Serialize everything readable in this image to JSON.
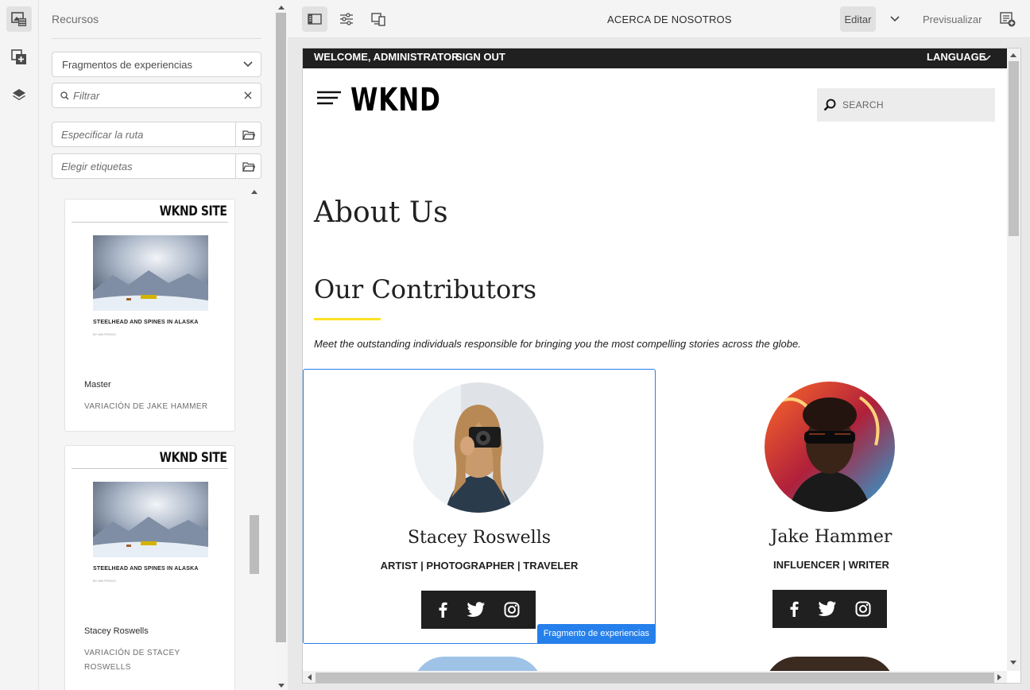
{
  "side_panel": {
    "title": "Recursos",
    "type_select": "Fragmentos de experiencias",
    "filter_placeholder": "Filtrar",
    "path_placeholder": "Especificar la ruta",
    "tags_placeholder": "Elegir etiquetas",
    "cards": [
      {
        "thumb_header": "WKND SITE",
        "thumb_caption": "STEELHEAD AND SPINES IN ALASKA",
        "thumb_byline": "BY IAN PROVO",
        "title": "Master",
        "subtitle": "VARIACIÓN DE JAKE HAMMER"
      },
      {
        "thumb_header": "WKND SITE",
        "thumb_caption": "STEELHEAD AND SPINES IN ALASKA",
        "thumb_byline": "BY IAN PROVO",
        "title": "Stacey Roswells",
        "subtitle": "VARIACIÓN DE STACEY ROSWELLS"
      }
    ]
  },
  "toolbar": {
    "page_name": "ACERCA DE NOSOTROS",
    "edit_label": "Editar",
    "preview_label": "Previsualizar"
  },
  "site": {
    "welcome": "WELCOME, ADMINISTRATOR",
    "sign_out": "SIGN OUT",
    "language": "LANGUAGE",
    "logo": "WKND",
    "search_placeholder": "SEARCH",
    "heading": "About Us",
    "subheading": "Our Contributors",
    "intro": "Meet the outstanding individuals responsible for bringing you the most compelling stories across the globe.",
    "contributors": [
      {
        "name": "Stacey Roswells",
        "role": "ARTIST | PHOTOGRAPHER | TRAVELER"
      },
      {
        "name": "Jake Hammer",
        "role": "INFLUENCER | WRITER"
      }
    ],
    "fragment_badge": "Fragmento de experiencias"
  },
  "colors": {
    "accent": "#2680eb",
    "brand_yellow": "#ffe123",
    "dark": "#202020"
  }
}
